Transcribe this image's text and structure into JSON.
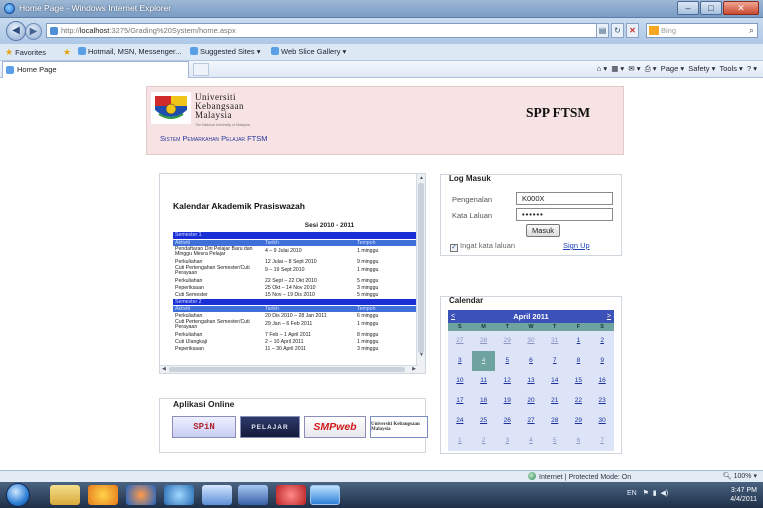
{
  "window": {
    "title": "Home Page - Windows Internet Explorer"
  },
  "address_bar": {
    "url_prefix": "http://",
    "url_host": "localhost",
    "url_rest": ":3275/Grading%20System/home.aspx",
    "search_placeholder": "Bing"
  },
  "favorites_bar": {
    "favorites_label": "Favorites",
    "items": [
      "Hotmail, MSN, Messenger...",
      "Suggested Sites ▾",
      "Web Slice Gallery ▾"
    ]
  },
  "tab": {
    "label": "Home Page"
  },
  "command_bar": {
    "items": [
      "Page ▾",
      "Safety ▾",
      "Tools ▾"
    ]
  },
  "header": {
    "university_line1": "Universiti",
    "university_line2": "Kebangsaan",
    "university_line3": "Malaysia",
    "university_motto": "The National University of Malaysia",
    "system_title": "Sistem Pemarkahan Pelajar FTSM",
    "brand": "SPP FTSM"
  },
  "kalendar": {
    "title": "Kalendar Akademik Prasiswazah",
    "session": "Sesi 2010 - 2011",
    "rows": [
      {
        "type": "sem",
        "c1": "Semester 1",
        "c2": "",
        "c3": ""
      },
      {
        "type": "hdr",
        "c1": "Aktiviti",
        "c2": "Tarikh",
        "c3": "Tempoh"
      },
      {
        "type": "twoline",
        "c1": "Pendaftaran Diri Pelajar Baru dan Minggu Mesra Pelajar",
        "c2": "4 – 9 Julai 2010",
        "c3": "1 minggu"
      },
      {
        "type": "row",
        "c1": "Perkuliahan",
        "c2": "12 Julai – 8 Sept 2010",
        "c3": "9 minggu"
      },
      {
        "type": "twoline",
        "c1": "Cuti Pertengahan Semester/Cuti Perayaan",
        "c2": "9 – 19 Sept 2010",
        "c3": "1 minggu"
      },
      {
        "type": "row",
        "c1": "Perkuliahan",
        "c2": "22 Sept – 22 Okt 2010",
        "c3": "5 minggu"
      },
      {
        "type": "row",
        "c1": "Peperiksaan",
        "c2": "25 Okt – 14 Nov 2010",
        "c3": "3 minggu"
      },
      {
        "type": "row",
        "c1": "Cuti Semester",
        "c2": "15 Nov – 19 Dis 2010",
        "c3": "5 minggu"
      },
      {
        "type": "sem",
        "c1": "Semester 2",
        "c2": "",
        "c3": ""
      },
      {
        "type": "hdr",
        "c1": "Aktiviti",
        "c2": "Tarikh",
        "c3": "Tempoh"
      },
      {
        "type": "row",
        "c1": "Perkuliahan",
        "c2": "20 Dis 2010 – 28 Jan 2011",
        "c3": "6 minggu"
      },
      {
        "type": "twoline",
        "c1": "Cuti Pertengahan Semester/Cuti Perayaan",
        "c2": "29 Jan – 6 Feb 2011",
        "c3": "1 minggu"
      },
      {
        "type": "row",
        "c1": "Perkuliahan",
        "c2": "7 Feb – 1 April 2011",
        "c3": "8 minggu"
      },
      {
        "type": "row",
        "c1": "Cuti Ulangkaji",
        "c2": "2 – 10 April 2011",
        "c3": "1 minggu"
      },
      {
        "type": "row",
        "c1": "Peperiksaan",
        "c2": "11 – 30 April 2011",
        "c3": "3 minggu"
      },
      {
        "type": "row",
        "c1": "Cuti Semester",
        "c2": "1 Mei – 24 Julai 2011",
        "c3": "12 minggu"
      }
    ]
  },
  "aplikasi": {
    "title": "Aplikasi Online",
    "links": [
      "SPiN",
      "PELAJAR",
      "SMPweb",
      "Universiti Kebangsaan Malaysia"
    ]
  },
  "login": {
    "title": "Log Masuk",
    "username_label": "Pengenalan",
    "username_value": "K000X",
    "password_label": "Kata Laluan",
    "password_value": "••••••",
    "submit_label": "Masuk",
    "remember_label": "Ingat kata laluan",
    "signup_label": "Sign Up"
  },
  "calendar": {
    "title": "Calendar",
    "month": "April 2011",
    "prev": "<",
    "next": ">",
    "weekdays": [
      "S",
      "M",
      "T",
      "W",
      "T",
      "F",
      "S"
    ],
    "days": [
      {
        "d": "27",
        "other": true
      },
      {
        "d": "28",
        "other": true
      },
      {
        "d": "29",
        "other": true
      },
      {
        "d": "30",
        "other": true
      },
      {
        "d": "31",
        "other": true
      },
      {
        "d": "1"
      },
      {
        "d": "2"
      },
      {
        "d": "3"
      },
      {
        "d": "4",
        "selected": true
      },
      {
        "d": "5"
      },
      {
        "d": "6"
      },
      {
        "d": "7"
      },
      {
        "d": "8"
      },
      {
        "d": "9"
      },
      {
        "d": "10"
      },
      {
        "d": "11"
      },
      {
        "d": "12"
      },
      {
        "d": "13"
      },
      {
        "d": "14"
      },
      {
        "d": "15"
      },
      {
        "d": "16"
      },
      {
        "d": "17"
      },
      {
        "d": "18"
      },
      {
        "d": "19"
      },
      {
        "d": "20"
      },
      {
        "d": "21"
      },
      {
        "d": "22"
      },
      {
        "d": "23"
      },
      {
        "d": "24"
      },
      {
        "d": "25"
      },
      {
        "d": "26"
      },
      {
        "d": "27"
      },
      {
        "d": "28"
      },
      {
        "d": "29"
      },
      {
        "d": "30"
      },
      {
        "d": "1",
        "other": true
      },
      {
        "d": "2",
        "other": true
      },
      {
        "d": "3",
        "other": true
      },
      {
        "d": "4",
        "other": true
      },
      {
        "d": "5",
        "other": true
      },
      {
        "d": "6",
        "other": true
      },
      {
        "d": "7",
        "other": true
      }
    ]
  },
  "status_bar": {
    "zone": "Internet | Protected Mode: On",
    "zoom": "100%"
  },
  "taskbar": {
    "language": "EN",
    "time": "3:47 PM",
    "date": "4/4/2011"
  }
}
